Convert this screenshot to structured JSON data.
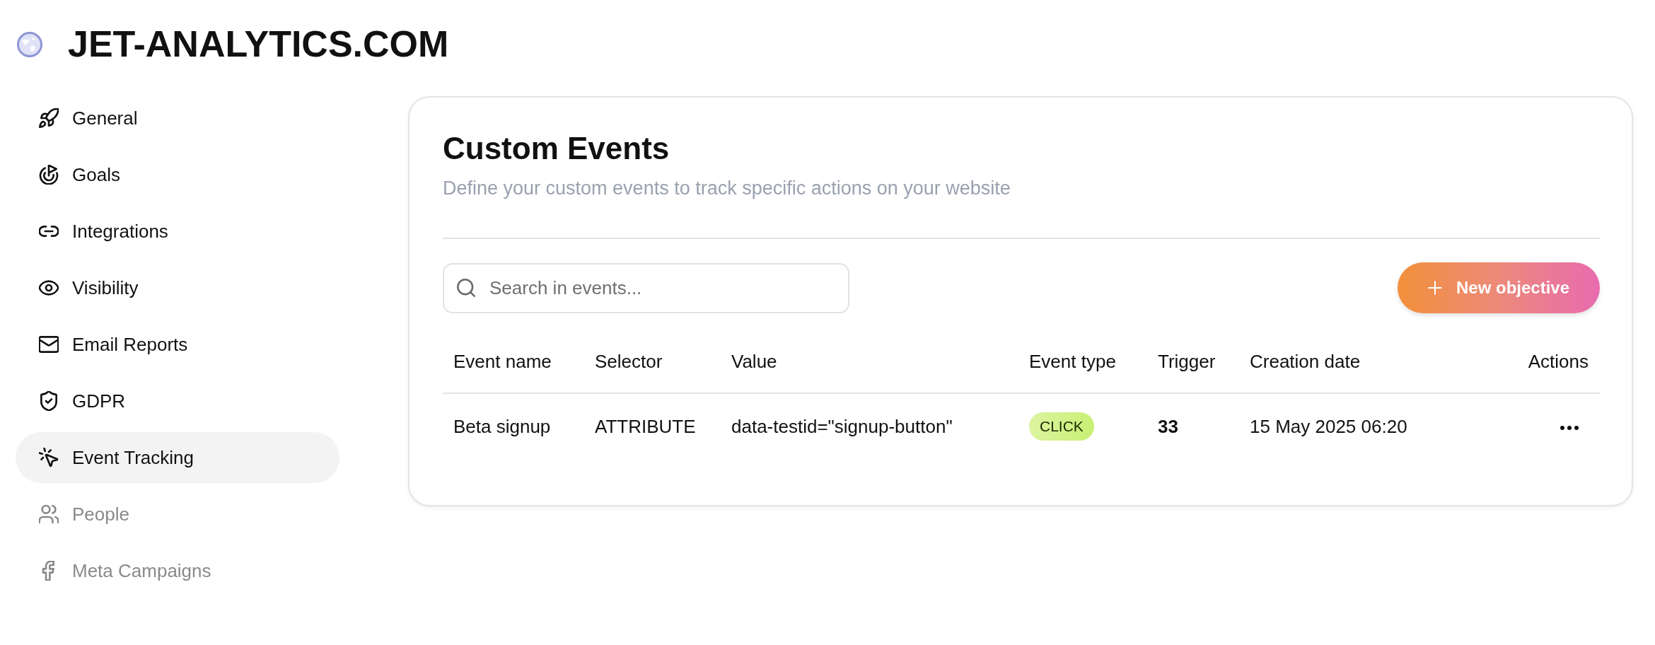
{
  "site": {
    "title": "JET-ANALYTICS.COM"
  },
  "sidebar": {
    "items": [
      {
        "label": "General",
        "selected": false,
        "disabled": false
      },
      {
        "label": "Goals",
        "selected": false,
        "disabled": false
      },
      {
        "label": "Integrations",
        "selected": false,
        "disabled": false
      },
      {
        "label": "Visibility",
        "selected": false,
        "disabled": false
      },
      {
        "label": "Email Reports",
        "selected": false,
        "disabled": false
      },
      {
        "label": "GDPR",
        "selected": false,
        "disabled": false
      },
      {
        "label": "Event Tracking",
        "selected": true,
        "disabled": false
      },
      {
        "label": "People",
        "selected": false,
        "disabled": true
      },
      {
        "label": "Meta Campaigns",
        "selected": false,
        "disabled": true
      }
    ]
  },
  "panel": {
    "title": "Custom Events",
    "subtitle": "Define your custom events to track specific actions on your website",
    "search": {
      "placeholder": "Search in events..."
    },
    "new_button": {
      "label": "New objective"
    },
    "table": {
      "columns": [
        "Event name",
        "Selector",
        "Value",
        "Event type",
        "Trigger",
        "Creation date",
        "Actions"
      ],
      "rows": [
        {
          "event_name": "Beta signup",
          "selector": "ATTRIBUTE",
          "value": "data-testid=\"signup-button\"",
          "event_type": "CLICK",
          "trigger": "33",
          "creation_date": "15 May 2025 06:20"
        }
      ]
    }
  }
}
